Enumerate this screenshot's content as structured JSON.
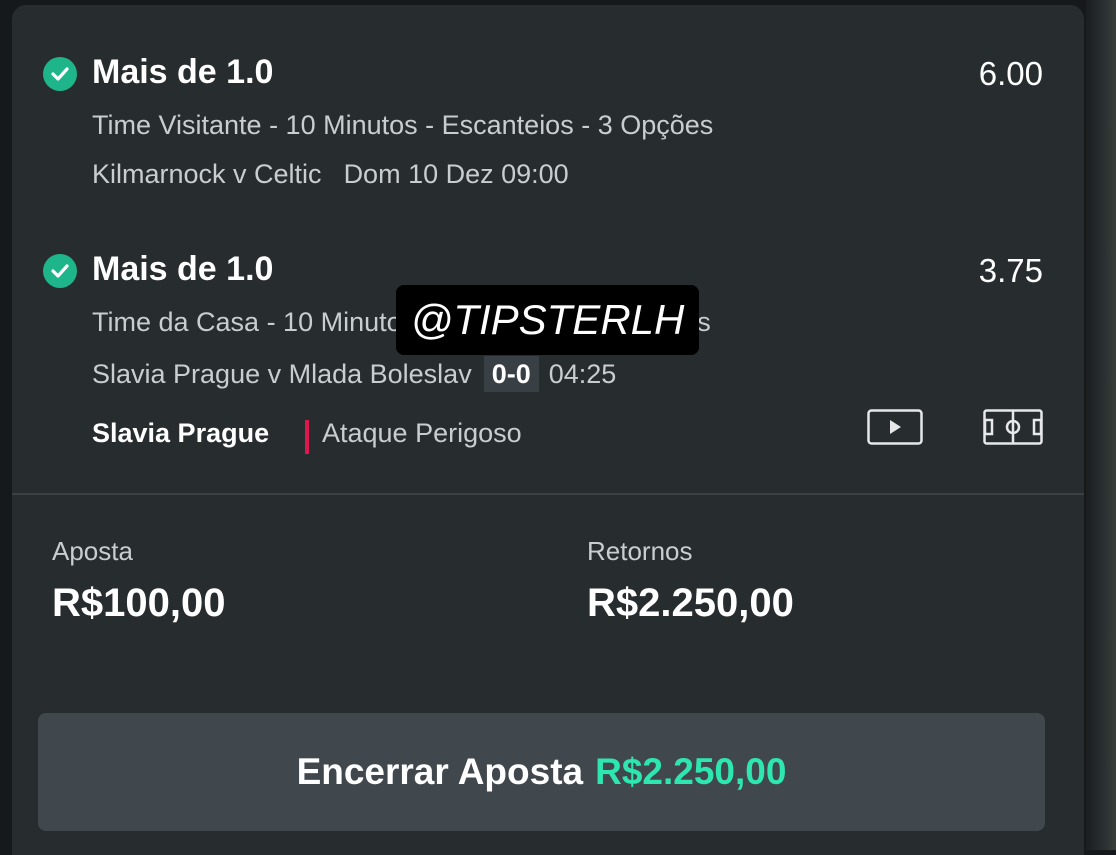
{
  "selections": [
    {
      "title": "Mais de 1.0",
      "odds": "6.00",
      "market": "Time Visitante - 10 Minutos - Escanteios - 3 Opções",
      "match": "Kilmarnock v Celtic",
      "datetime": "Dom 10 Dez 09:00"
    },
    {
      "title": "Mais de 1.0",
      "odds": "3.75",
      "market": "Time da Casa - 10 Minutos - Escanteios - 3 Opções",
      "match": "Slavia Prague v Mlada Boleslav",
      "score": "0-0",
      "clock": "04:25",
      "live_team": "Slavia Prague",
      "live_state": "Ataque Perigoso"
    }
  ],
  "watermark": "@TIPSTERLH",
  "stake": {
    "label": "Aposta",
    "value": "R$100,00"
  },
  "returns": {
    "label": "Retornos",
    "value": "R$2.250,00"
  },
  "cashout": {
    "label": "Encerrar Aposta",
    "amount": "R$2.250,00"
  },
  "colors": {
    "accent": "#2ee6b0",
    "check": "#1fb58b",
    "live_indicator": "#e0174f",
    "card_bg": "#272c2f"
  },
  "icons": [
    "check-icon",
    "play-video-icon",
    "pitch-view-icon"
  ]
}
